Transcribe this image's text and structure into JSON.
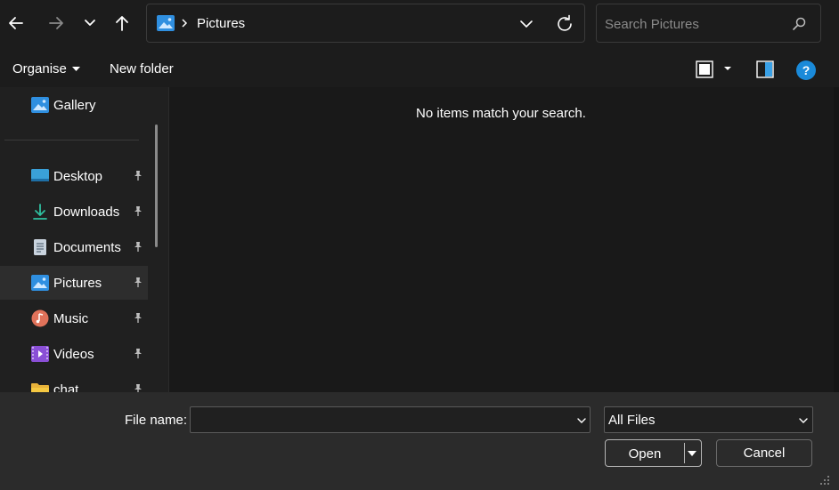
{
  "toolbar": {
    "breadcrumb": "Pictures",
    "search_placeholder": "Search Pictures"
  },
  "commands": {
    "organise": "Organise",
    "new_folder": "New folder",
    "help": "?"
  },
  "sidebar": {
    "items": [
      {
        "label": "Gallery",
        "icon": "gallery-icon",
        "pinned": false
      },
      {
        "label": "Desktop",
        "icon": "desktop-icon",
        "pinned": true
      },
      {
        "label": "Downloads",
        "icon": "download-icon",
        "pinned": true
      },
      {
        "label": "Documents",
        "icon": "document-icon",
        "pinned": true
      },
      {
        "label": "Pictures",
        "icon": "pictures-icon",
        "pinned": true,
        "selected": true
      },
      {
        "label": "Music",
        "icon": "music-icon",
        "pinned": true
      },
      {
        "label": "Videos",
        "icon": "videos-icon",
        "pinned": true
      },
      {
        "label": "chat",
        "icon": "folder-icon",
        "pinned": true
      }
    ]
  },
  "content": {
    "empty_message": "No items match your search."
  },
  "footer": {
    "file_name_label": "File name:",
    "file_name_value": "",
    "file_type_value": "All Files",
    "open_label": "Open",
    "cancel_label": "Cancel"
  },
  "colors": {
    "background": "#1c1c1c",
    "content_bg": "#191919",
    "footer_bg": "#2b2b2b",
    "accent_blue": "#1a8ad9"
  }
}
